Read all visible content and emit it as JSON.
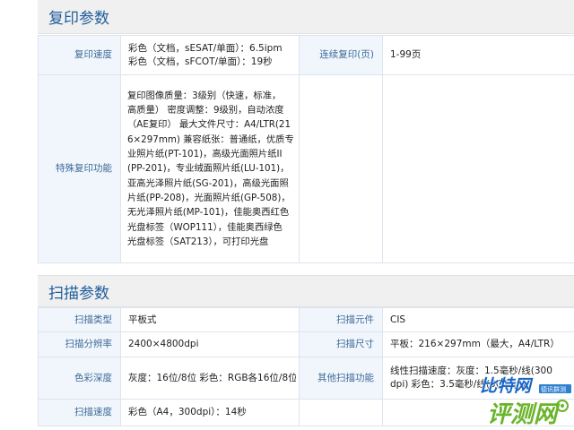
{
  "copy_section": {
    "title": "复印参数",
    "rows": [
      {
        "label": "复印速度",
        "values": [
          "彩色（文档，sESAT/单面）：6.5ipm",
          "彩色（文档，sFCOT/单面）：19秒"
        ],
        "label2": "连续复印(页)",
        "value2": "1-99页"
      },
      {
        "label": "特殊复印功能",
        "lines": [
          "复印图像质量：3级别（快速，标准，",
          "高质量） 密度调整：9级别，自动浓度",
          "（AE复印） 最大文件尺寸：A4/LTR(21",
          "6×297mm) 兼容纸张：普通纸，优质专",
          "业照片纸(PT-101)，高级光面照片纸II",
          "(PP-201)，专业绒面照片纸(LU-101)，",
          "亚高光泽照片纸(SG-201)，高级光面照",
          "片纸(PP-208)，光面照片纸(GP-508)，",
          "无光泽照片纸(MP-101)，佳能奥西红色",
          "光盘标签（WOP111），佳能奥西绿色",
          "光盘标签（SAT213），可打印光盘"
        ]
      }
    ]
  },
  "scan_section": {
    "title": "扫描参数",
    "rows": [
      {
        "label": "扫描类型",
        "value": "平板式",
        "label2": "扫描元件",
        "value2": "CIS"
      },
      {
        "label": "扫描分辨率",
        "value": "2400×4800dpi",
        "label2": "扫描尺寸",
        "value2": "平板：216×297mm（最大，A4/LTR）"
      },
      {
        "label": "色彩深度",
        "value": "灰度：16位/8位 彩色：RGB各16位/8位",
        "label2": "其他扫描功能",
        "value2_lines": [
          "线性扫描速度：灰度：1.5毫秒/线(300",
          "dpi) 彩色：3.5毫秒/线(300dpi)"
        ]
      },
      {
        "label": "扫描速度",
        "value": "彩色（A4，300dpi）：14秒",
        "label2": "",
        "value2": ""
      }
    ]
  },
  "watermark": {
    "text1": "比特网",
    "text2": "评测网",
    "tag": "德讯群测"
  },
  "colors": {
    "title_blue": "#1f5d9c",
    "label_bg": "#f1f6fc",
    "label_text": "#3d6a98",
    "border": "#dde4ee",
    "watermark_green": "#6ab42a"
  }
}
